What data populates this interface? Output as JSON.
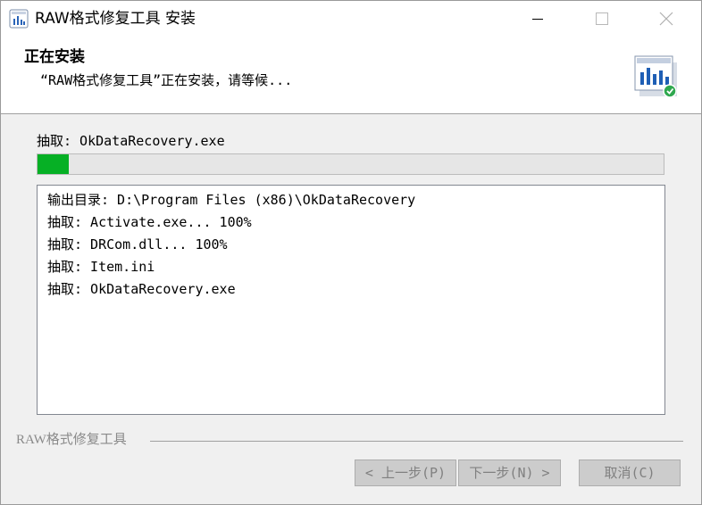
{
  "window": {
    "title": "RAW格式修复工具 安装",
    "app_icon": "installer-chart-icon"
  },
  "header": {
    "title": "正在安装",
    "subtitle": "“RAW格式修复工具”正在安装，请等候...",
    "icon": "installer-chart-icon"
  },
  "status": {
    "current": "抽取: OkDataRecovery.exe",
    "progress_percent": 5
  },
  "log": {
    "lines": [
      "输出目录: D:\\Program Files (x86)\\OkDataRecovery",
      "抽取: Activate.exe... 100%",
      "抽取: DRCom.dll... 100%",
      "抽取: Item.ini",
      "抽取: OkDataRecovery.exe"
    ]
  },
  "footer": {
    "brand": "RAW格式修复工具"
  },
  "buttons": {
    "back": "< 上一步(P)",
    "next": "下一步(N) >",
    "cancel": "取消(C)"
  },
  "colors": {
    "progress_fill": "#06b025",
    "button_bg": "#cccccc",
    "disabled_text": "#808080"
  }
}
